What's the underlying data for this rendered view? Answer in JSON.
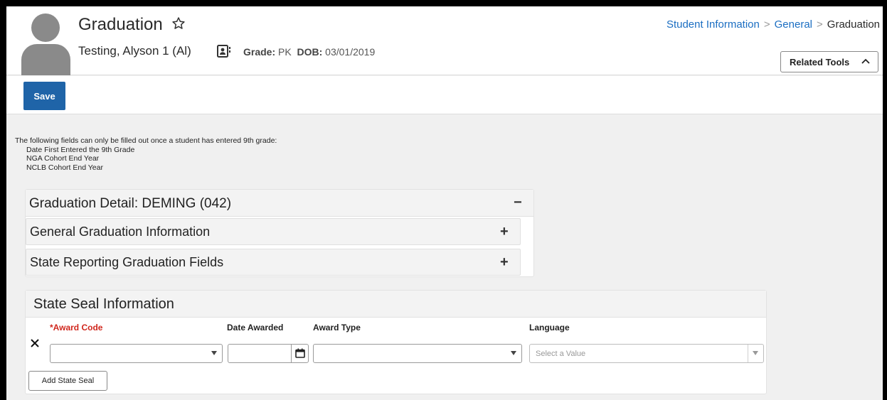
{
  "header": {
    "title": "Graduation",
    "student_name": "Testing, Alyson 1 (Al)",
    "grade_label": "Grade:",
    "grade_value": "PK",
    "dob_label": "DOB:",
    "dob_value": "03/01/2019"
  },
  "breadcrumb": {
    "items": [
      "Student Information",
      "General",
      "Graduation"
    ],
    "separator": ">"
  },
  "related_tools_label": "Related Tools",
  "toolbar": {
    "save_label": "Save"
  },
  "notice": {
    "intro": "The following fields can only be filled out once a student has entered 9th grade:",
    "items": [
      "Date First Entered the 9th Grade",
      "NGA Cohort End Year",
      "NCLB Cohort End Year"
    ]
  },
  "graduation_detail": {
    "title": "Graduation Detail: DEMING (042)",
    "toggle": "−",
    "sections": [
      {
        "title": "General Graduation Information",
        "toggle": "+"
      },
      {
        "title": "State Reporting Graduation Fields",
        "toggle": "+"
      }
    ]
  },
  "state_seal": {
    "title": "State Seal Information",
    "columns": {
      "award_code": "*Award Code",
      "date_awarded": "Date Awarded",
      "award_type": "Award Type",
      "language": "Language"
    },
    "row": {
      "award_code": "",
      "date_awarded": "",
      "award_type": "",
      "language_placeholder": "Select a Value"
    },
    "add_label": "Add State Seal"
  },
  "colors": {
    "primary": "#1f64a8",
    "link": "#1b6ec2",
    "required": "#d0271d",
    "avatar": "#8a8a8a"
  },
  "icons": [
    "star-icon",
    "contact-card-icon",
    "chevron-up-icon",
    "close-icon",
    "calendar-icon",
    "dropdown-arrow-icon"
  ]
}
